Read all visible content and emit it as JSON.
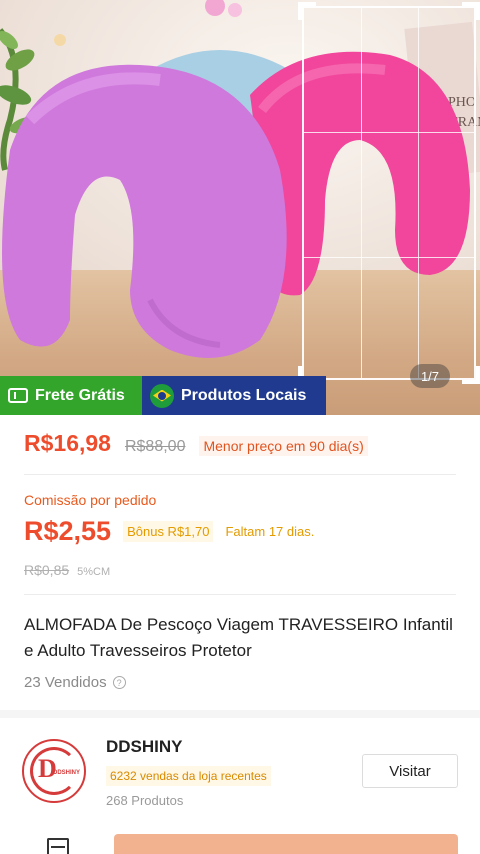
{
  "image": {
    "page_indicator": "1/7",
    "badges": {
      "free_shipping": "Frete Grátis",
      "local_products": "Produtos Locais"
    }
  },
  "price": {
    "current": "R$16,98",
    "original": "R$88,00",
    "tag": "Menor preço em 90 dia(s)"
  },
  "commission": {
    "label": "Comissão por pedido",
    "value": "R$2,55",
    "bonus": "Bônus R$1,70",
    "deadline": "Faltam 17 dias.",
    "old_value": "R$0,85",
    "rate": "5%CM"
  },
  "product": {
    "title": "ALMOFADA De Pescoço Viagem TRAVESSEIRO Infantil e Adulto Travesseiros Protetor",
    "sold": "23 Vendidos"
  },
  "shop": {
    "name": "DDSHINY",
    "logo_letter": "D",
    "logo_text": "DDSHINY",
    "recent_sales": "6232 vendas da loja recentes",
    "products": "268 Produtos",
    "visit_label": "Visitar"
  },
  "colors": {
    "accent": "#ee4d2d",
    "free_shipping_green": "#33a52b",
    "local_blue": "#1f3a8f",
    "bonus_amber": "#e39b00"
  },
  "icons": [
    "ticket-icon",
    "brazil-flag-icon",
    "info-icon",
    "store-icon"
  ]
}
